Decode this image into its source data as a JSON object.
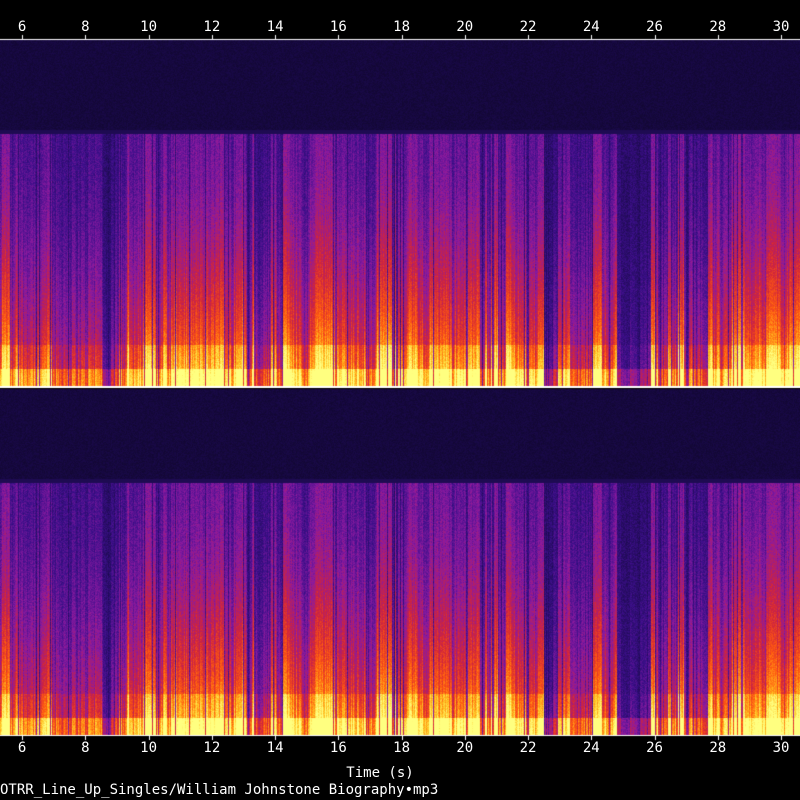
{
  "chart_data": {
    "type": "heatmap",
    "title": "",
    "xlabel": "Time (s)",
    "ylabel": "",
    "xlim": [
      5.3,
      30.6
    ],
    "x_ticks": [
      "6",
      "8",
      "10",
      "12",
      "14",
      "16",
      "18",
      "20",
      "22",
      "24",
      "26",
      "28",
      "30"
    ],
    "channels": 2,
    "colormap": [
      "#000000",
      "#1a0a4a",
      "#3c0f8a",
      "#8a1aa0",
      "#d0243c",
      "#ff5a10",
      "#ffc020",
      "#ffff80"
    ],
    "quiet_intervals_s": [
      [
        24.8,
        25.9
      ]
    ],
    "file_label": "OTRR_Line_Up_Singles/William Johnstone Biography•mp3"
  }
}
